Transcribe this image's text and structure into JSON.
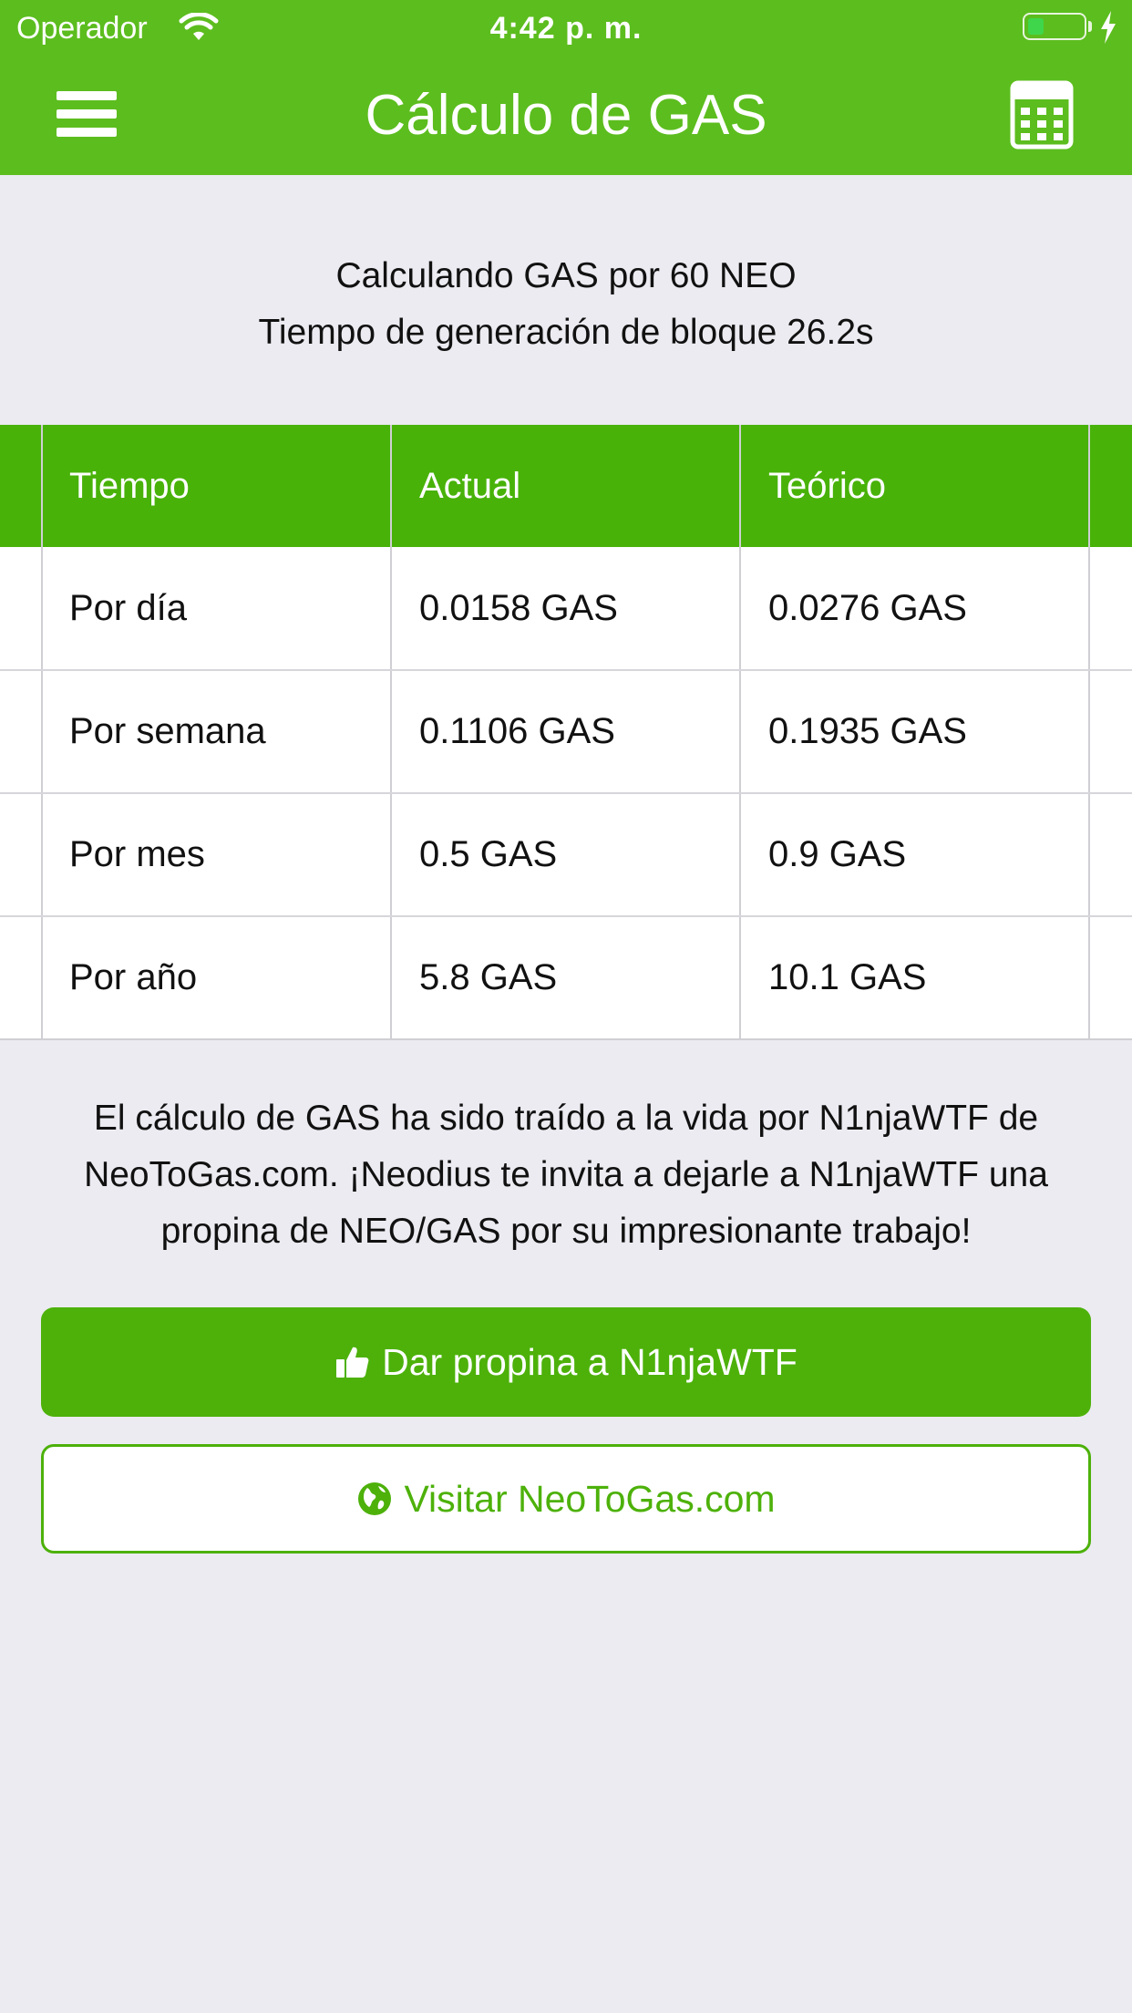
{
  "status_bar": {
    "carrier": "Operador",
    "time": "4:42 p. m.",
    "battery_level": 0.3,
    "icons": [
      "wifi-icon",
      "battery-icon",
      "charging-bolt-icon"
    ]
  },
  "nav": {
    "title": "Cálculo de GAS",
    "left_icon": "hamburger-menu-icon",
    "right_icon": "calculator-icon"
  },
  "summary": {
    "line1": "Calculando GAS por 60 NEO",
    "line2": "Tiempo de generación de bloque 26.2s"
  },
  "table": {
    "headers": [
      "Tiempo",
      "Actual",
      "Teórico"
    ],
    "rows": [
      [
        "Por día",
        "0.0158 GAS",
        "0.0276 GAS"
      ],
      [
        "Por semana",
        "0.1106 GAS",
        "0.1935 GAS"
      ],
      [
        "Por mes",
        "0.5 GAS",
        "0.9 GAS"
      ],
      [
        "Por año",
        "5.8 GAS",
        "10.1 GAS"
      ]
    ]
  },
  "credit": {
    "line1": "El cálculo de GAS ha sido traído a la vida por N1njaWTF de",
    "line2": "NeoToGas.com. ¡Neodius te invita a dejarle a N1njaWTF una",
    "line3": "propina de NEO/GAS por su impresionante trabajo!"
  },
  "buttons": {
    "tip_label": "Dar propina a N1njaWTF",
    "tip_icon": "thumbs-up-icon",
    "visit_label": "Visitar NeoToGas.com",
    "visit_icon": "globe-icon"
  },
  "colors": {
    "brand_green": "#5cbd1e",
    "header_green": "#48b208",
    "button_green": "#4db10a",
    "background": "#ebebf1"
  }
}
